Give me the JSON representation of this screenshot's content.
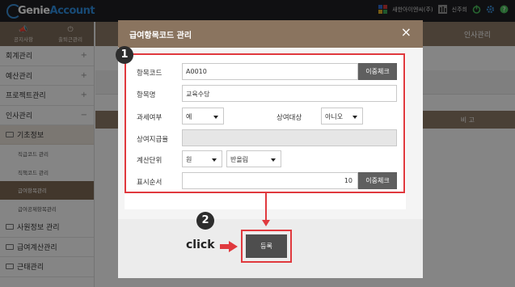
{
  "topbar": {
    "logo_prefix": "Genie",
    "logo_suffix": "Account",
    "company": "새한아이엔씨(주)",
    "user": "신주희"
  },
  "sidebar": {
    "head_buttons": [
      "공지사항",
      "출퇴근관리"
    ],
    "menu": [
      {
        "label": "회계관리",
        "sign": "+"
      },
      {
        "label": "예산관리",
        "sign": "+"
      },
      {
        "label": "프로젝트관리",
        "sign": "+"
      },
      {
        "label": "인사관리",
        "sign": "−"
      }
    ],
    "group1": "기초정보",
    "sub_items": [
      "직급코드 관리",
      "직책코드 관리",
      "급여항목관리",
      "급여공제항목관리"
    ],
    "group2": "사원정보 관리",
    "group3": "급여계산관리",
    "group4": "근태관리"
  },
  "main": {
    "tab_hr": "인사관리",
    "col_note": "비 고"
  },
  "modal": {
    "title": "급여항목코드 관리",
    "close": "×",
    "labels": {
      "code": "항목코드",
      "name": "항목명",
      "taxable": "과세여부",
      "bonus_target": "상여대상",
      "bonus_rate": "상여지급율",
      "calc_unit": "계산단위",
      "display_order": "표시순서"
    },
    "values": {
      "code": "A0010",
      "name": "교육수당",
      "taxable": "예",
      "bonus_target": "아니오",
      "bonus_rate": "",
      "calc_unit": "원",
      "rounding": "반올림",
      "display_order": "10"
    },
    "dup_check": "이중체크",
    "submit": "등록"
  },
  "annotations": {
    "badge1": "1",
    "badge2": "2",
    "click": "click",
    "accent": "#e0393e"
  }
}
